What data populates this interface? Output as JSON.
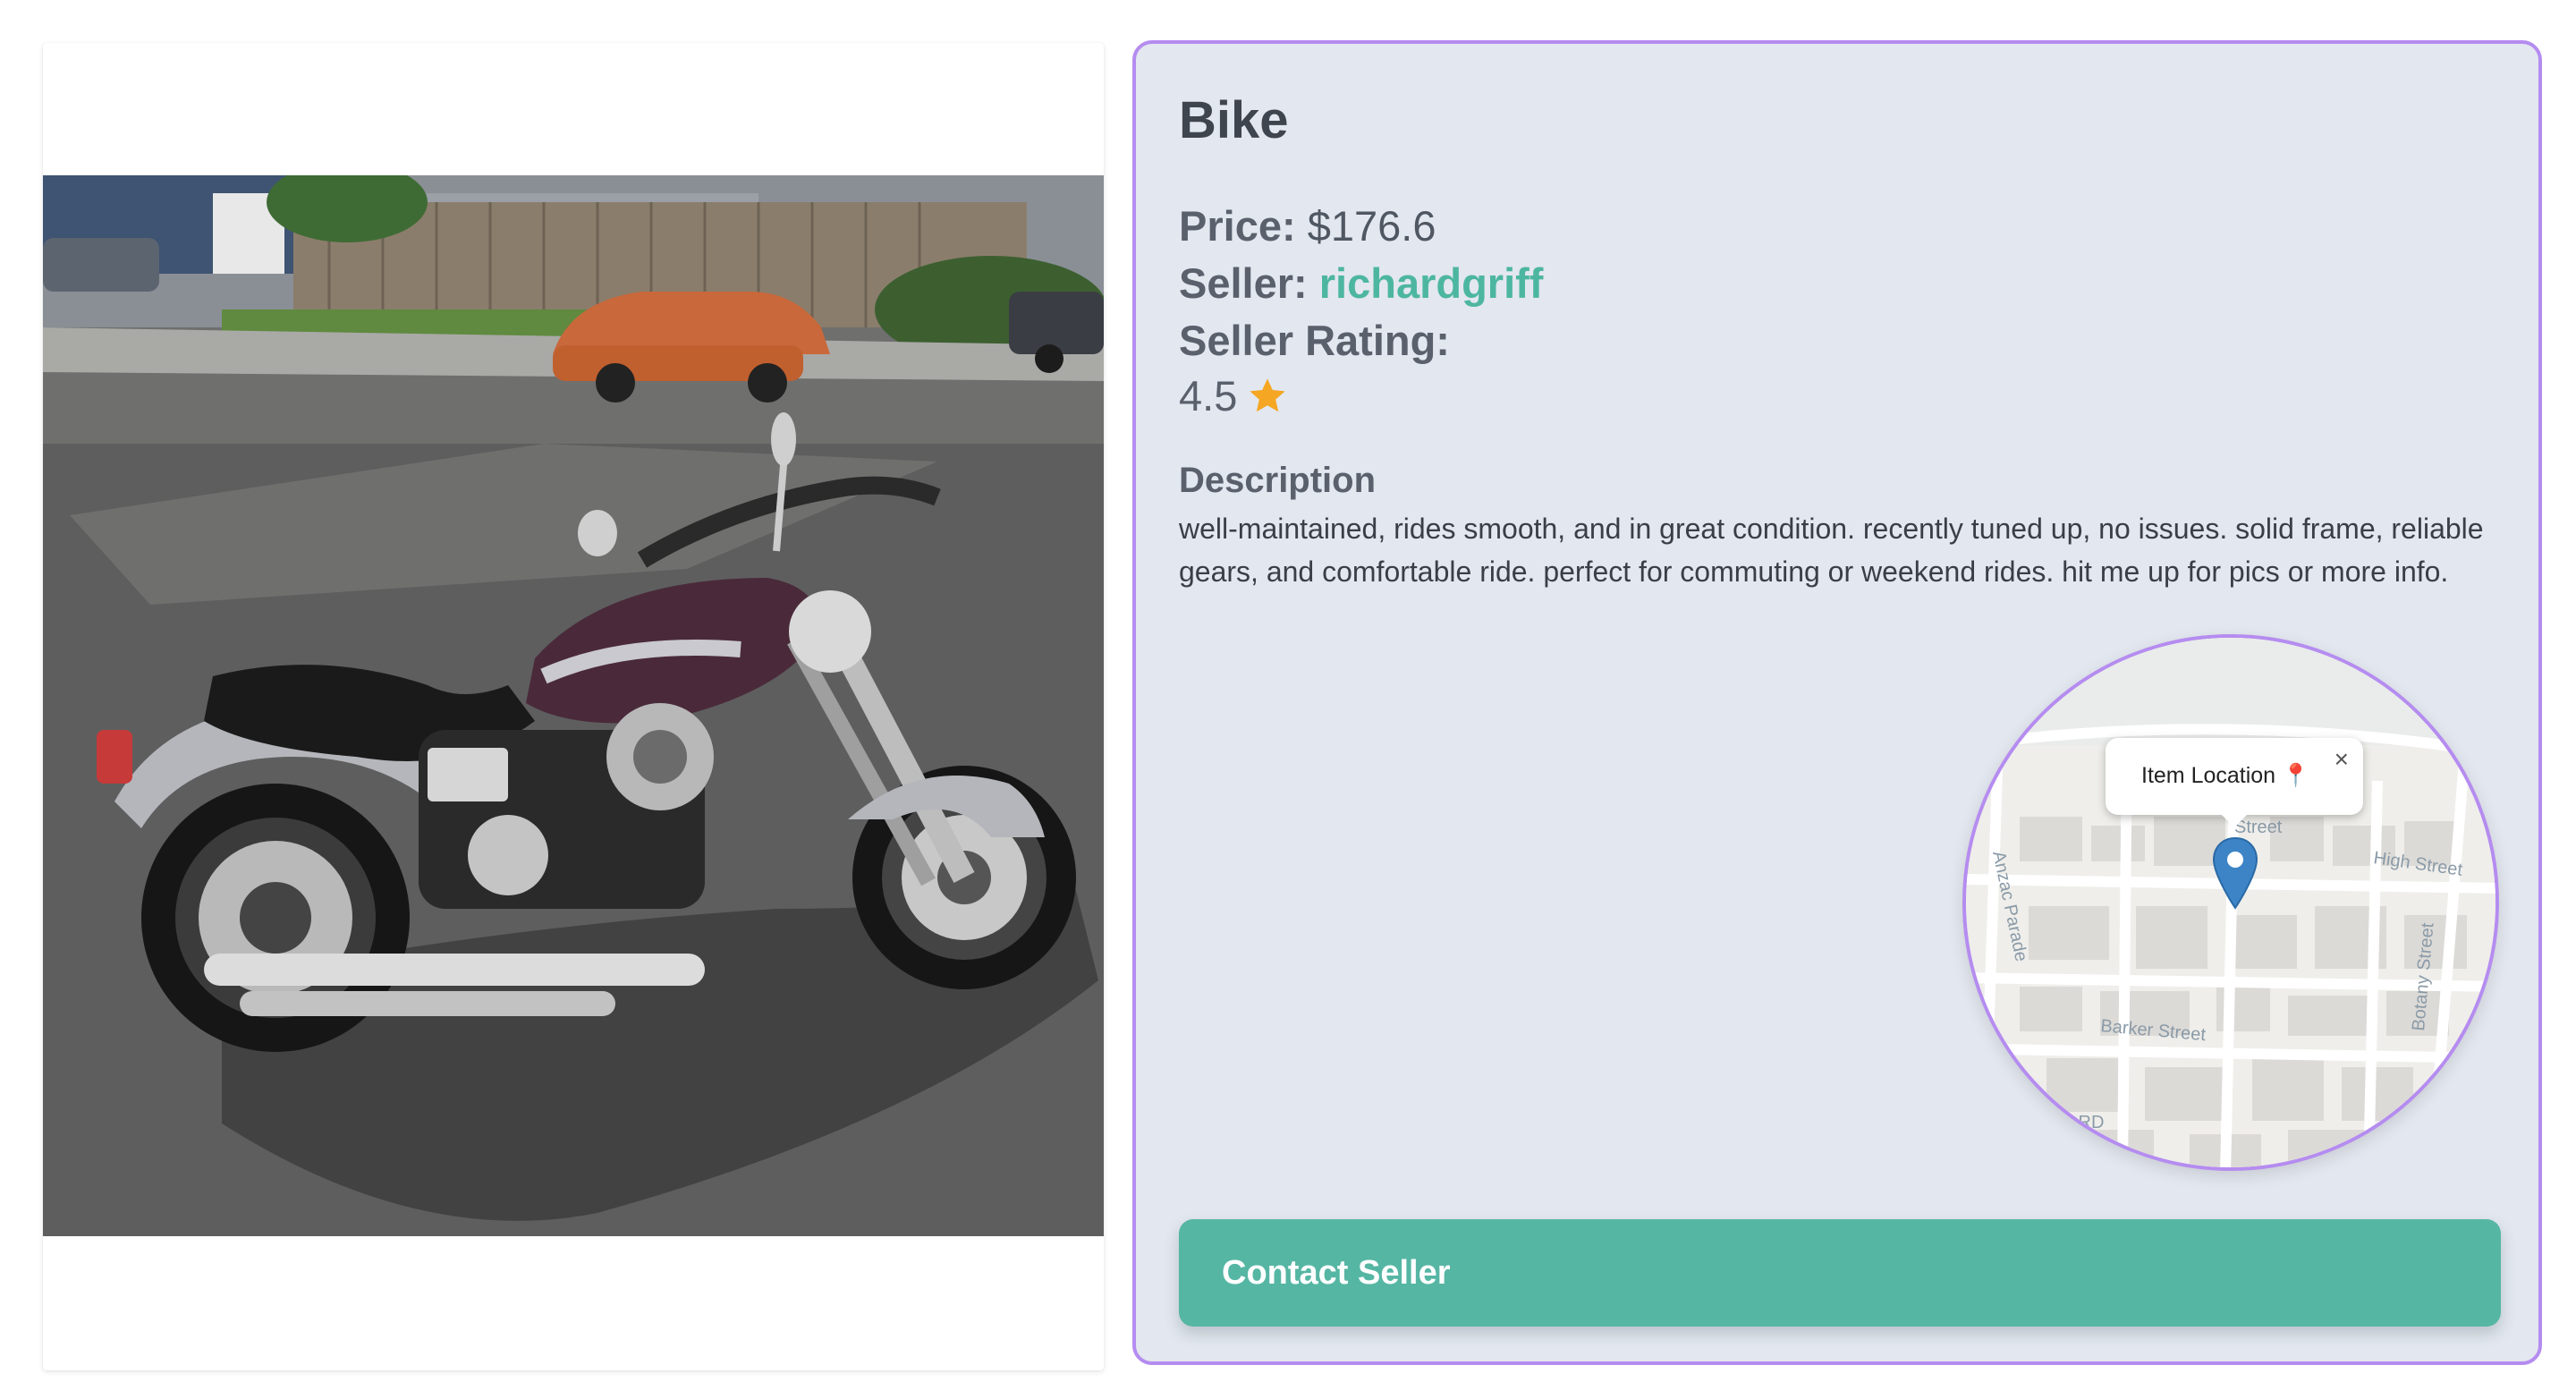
{
  "listing": {
    "title": "Bike",
    "price_label": "Price:",
    "price_value": "$176.6",
    "seller_label": "Seller:",
    "seller_name": "richardgriff",
    "rating_label": "Seller Rating:",
    "rating_value": "4.5",
    "rating_icon": "star-icon",
    "description_heading": "Description",
    "description_text": "well-maintained, rides smooth, and in great condition. recently tuned up, no issues. solid frame, reliable gears, and comfortable ride. perfect for commuting or weekend rides. hit me up for pics or more info."
  },
  "map": {
    "popup_text": "Item Location 📍",
    "close_glyph": "×",
    "street_labels": [
      "Street",
      "High Street",
      "Anzac Parade",
      "Botany Street",
      "Barker Street",
      "ORD"
    ],
    "pin_icon": "map-pin-icon"
  },
  "actions": {
    "contact_label": "Contact Seller"
  },
  "colors": {
    "accent": "#56b6a4",
    "seller_link": "#4db6a1",
    "card_border": "#b58cf0",
    "card_background": "#e3e7ef",
    "star": "#f5a623",
    "pin": "#3d84c6"
  }
}
